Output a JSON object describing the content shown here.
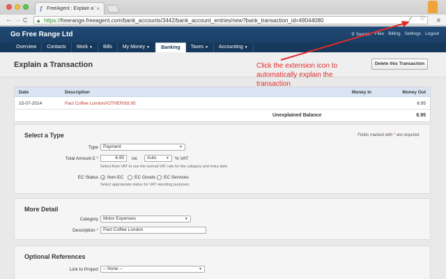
{
  "browser": {
    "tab_title": "FreeAgent : Explain a Tra",
    "tab_favicon": "freeagent-logo-icon",
    "close_glyph": "×",
    "url_scheme": "https://",
    "url_rest": "freerange.freeagent.com/bank_accounts/3442/bank_account_entries/new?bank_transaction_id=49044080",
    "nav": {
      "back": "←",
      "forward": "→",
      "reload": "C"
    },
    "ext_glyph": "⁄",
    "star_glyph": "☆",
    "menu_glyph": "≡"
  },
  "header": {
    "company": "Go Free Range Ltd",
    "top_links": [
      "Search",
      "Files",
      "Billing",
      "Settings",
      "Logout"
    ]
  },
  "nav": {
    "items": [
      {
        "label": "Overview",
        "dropdown": false
      },
      {
        "label": "Contacts",
        "dropdown": false
      },
      {
        "label": "Work",
        "dropdown": true
      },
      {
        "label": "Bills",
        "dropdown": false
      },
      {
        "label": "My Money",
        "dropdown": true
      },
      {
        "label": "Banking",
        "dropdown": false
      },
      {
        "label": "Taxes",
        "dropdown": true
      },
      {
        "label": "Accounting",
        "dropdown": true
      }
    ],
    "active": "Banking",
    "caret": "▼"
  },
  "page": {
    "title": "Explain a Transaction",
    "delete_button": "Delete this Transaction"
  },
  "annotation": {
    "text": "Click the extension icon to automatically explain the transaction",
    "color": "#e32b2b"
  },
  "table": {
    "headers": {
      "date": "Date",
      "description": "Description",
      "money_in": "Money In",
      "money_out": "Money Out"
    },
    "row": {
      "date": "15-07-2014",
      "description": "Pact Coffee London//OTHER/£6.95",
      "money_in": "",
      "money_out": "6.95"
    },
    "balance_label": "Unexplained Balance",
    "balance_value": "6.95"
  },
  "select_type": {
    "title": "Select a Type",
    "required_note_before": "Fields marked with",
    "required_star": "*",
    "required_note_after": "are required.",
    "type_label": "Type",
    "type_value": "Payment",
    "amount_label": "Total Amount £",
    "amount_value": "6.95",
    "inc_label": "inc",
    "vat_select": "Auto",
    "vat_suffix": "% VAT",
    "vat_hint": "Select Auto VAT to use the normal VAT rate for the category and entry date.",
    "ec_label": "EC Status",
    "ec_options": [
      "Non-EC",
      "EC Goods",
      "EC Services"
    ],
    "ec_selected": 0,
    "ec_hint": "Select appropriate status for VAT reporting purposes"
  },
  "more_detail": {
    "title": "More Detail",
    "category_label": "Category",
    "category_value": "Motor Expenses",
    "description_label": "Description",
    "description_value": "Pact Coffee London"
  },
  "optional_refs": {
    "title": "Optional References",
    "project_label": "Link to Project",
    "project_value": "-- None --"
  },
  "dropdown_arrow": "▼"
}
